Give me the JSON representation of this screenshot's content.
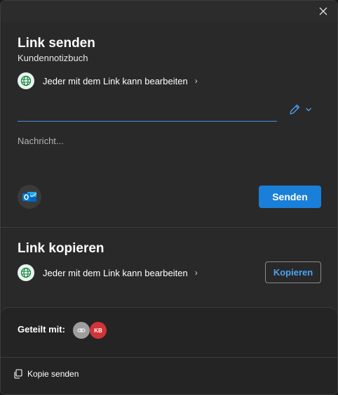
{
  "send_section": {
    "title": "Link senden",
    "subtitle": "Kundennotizbuch",
    "permission_text": "Jeder mit dem Link kann bearbeiten",
    "recipients_value": "",
    "message_placeholder": "Nachricht...",
    "send_label": "Senden"
  },
  "copy_section": {
    "title": "Link kopieren",
    "permission_text": "Jeder mit dem Link kann bearbeiten",
    "copy_label": "Kopieren"
  },
  "shared": {
    "label": "Geteilt mit:",
    "avatars": [
      {
        "kind": "link-icon"
      },
      {
        "initials": "KB"
      }
    ]
  },
  "footer": {
    "send_copy_label": "Kopie senden"
  },
  "colors": {
    "accent": "#1a7fd9",
    "copy_text": "#4ba3f5",
    "kb_avatar": "#d13438",
    "globe_bg": "#e6f4ea"
  }
}
